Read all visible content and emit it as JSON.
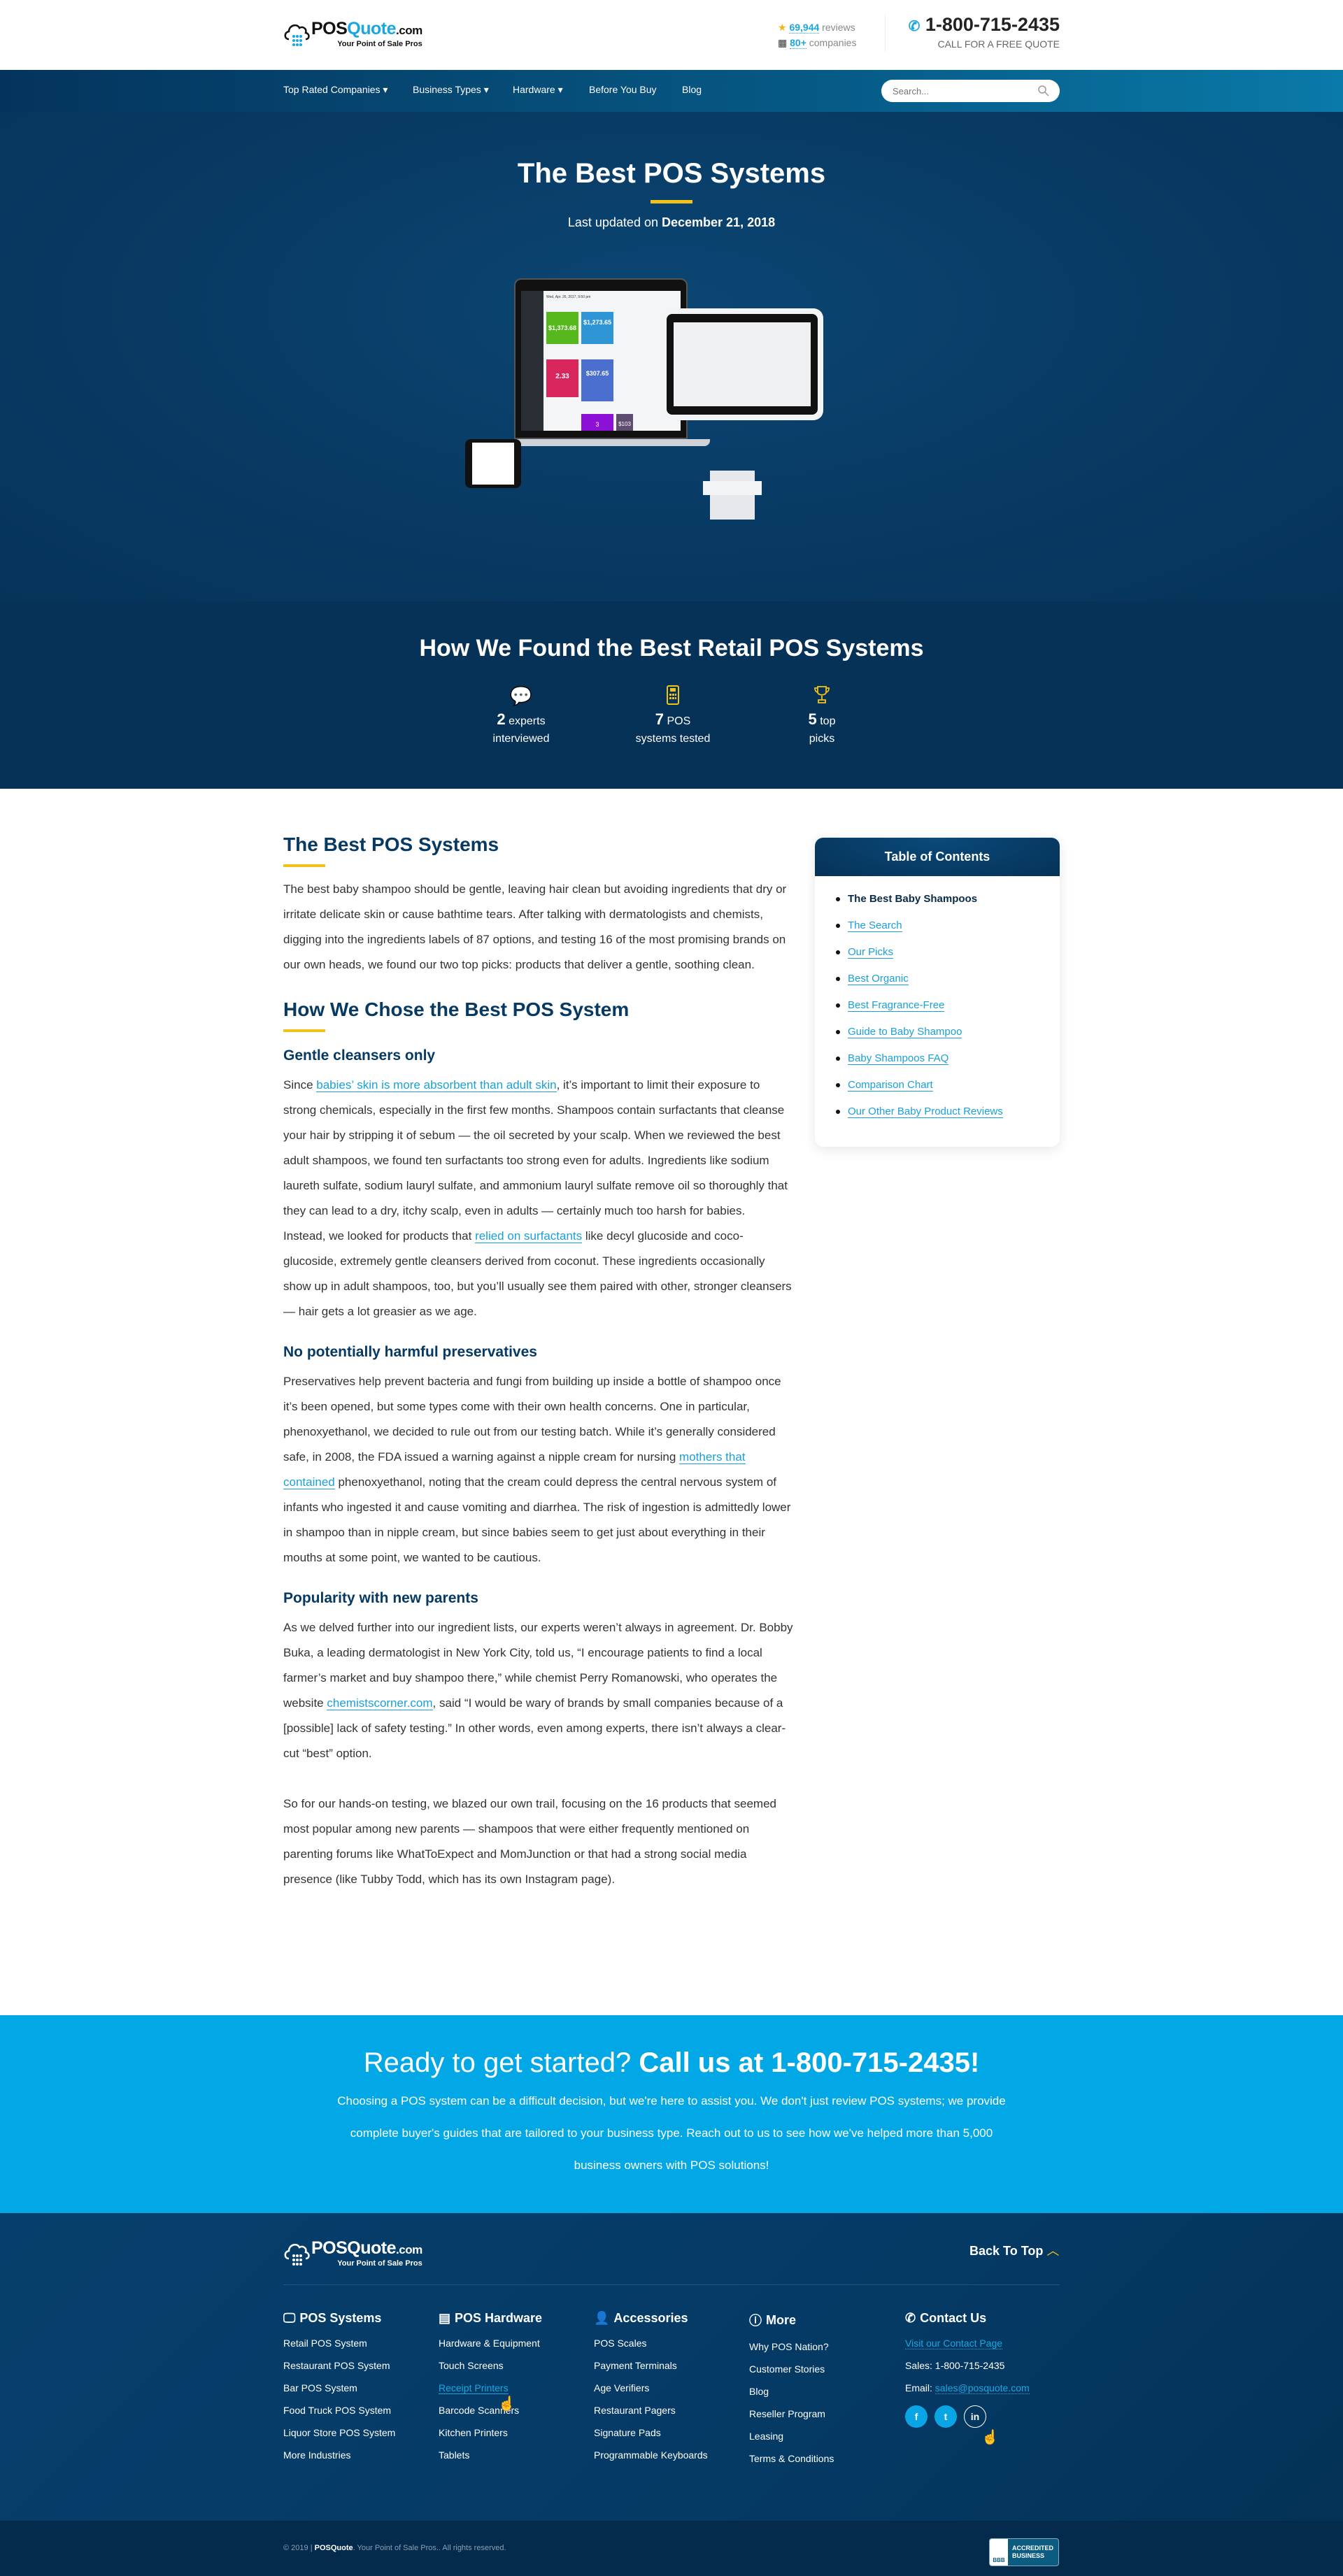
{
  "header": {
    "logo_brand_a": "POS",
    "logo_brand_b": "Quote",
    "logo_brand_c": ".com",
    "logo_tagline": "Your Point of Sale Pros",
    "reviews_count": "69,944",
    "reviews_label": "reviews",
    "companies_count": "80+",
    "companies_label": "companies",
    "phone": "1-800-715-2435",
    "phone_sub": "CALL FOR A FREE QUOTE"
  },
  "nav": {
    "items": [
      {
        "label": "Top Rated Companies",
        "dropdown": true
      },
      {
        "label": "Business Types",
        "dropdown": true
      },
      {
        "label": "Hardware",
        "dropdown": true
      },
      {
        "label": "Before You Buy",
        "dropdown": false
      },
      {
        "label": "Blog",
        "dropdown": false
      }
    ],
    "search_placeholder": "Search..."
  },
  "hero": {
    "title": "The Best POS Systems",
    "updated_prefix": "Last updated on",
    "updated_date": "December 21, 2018",
    "device_screen": {
      "date": "Wed, Apr. 26, 2017, 9:50 pm",
      "deposits_value": "$1,373.68",
      "gross_sales_value": "$1,273.65",
      "visits_value": "2.33",
      "invoices_value": "$307.65",
      "customers_value": "3",
      "spending_value": "$103"
    }
  },
  "stats": {
    "title": "How We Found the Best Retail POS Systems",
    "items": [
      {
        "icon": "chat-bubbles-icon",
        "num": "2",
        "l1": "experts",
        "l2": "interviewed"
      },
      {
        "icon": "pos-terminal-icon",
        "num": "7",
        "l1": "POS",
        "l2": "systems tested"
      },
      {
        "icon": "trophy-icon",
        "num": "5",
        "l1": "top",
        "l2": "picks"
      }
    ]
  },
  "article": {
    "h_best": "The Best POS Systems",
    "p_intro": "The best baby shampoo should be gentle, leaving hair clean but avoiding ingredients that dry or irritate delicate skin or cause bathtime tears. After talking with dermatologists and chemists, digging into the ingredients labels of 87 options, and testing 16 of the most promising brands on our own heads, we found our two top picks: products that deliver a gentle, soothing clean.",
    "h_chose": "How We Chose the Best POS System",
    "h_gentle": "Gentle cleansers only",
    "p_gentle1_a": "Since ",
    "p_gentle1_link": "babies’ skin is more absorbent than adult skin",
    "p_gentle1_b": ", it’s important to limit their exposure to strong chemicals, especially in the first few months. Shampoos contain surfactants that cleanse your hair by stripping it of sebum — the oil secreted by your scalp. When we reviewed the best adult shampoos, we found ten surfactants too strong even for adults. Ingredients like sodium laureth sulfate, sodium lauryl sulfate, and ammonium lauryl sulfate remove oil so thoroughly that they can lead to a dry, itchy scalp, even in adults — certainly much too harsh for babies.",
    "p_gentle2_a": "Instead, we looked for products that ",
    "p_gentle2_link": "relied on surfactants",
    "p_gentle2_b": " like decyl glucoside and coco-glucoside, extremely gentle cleansers derived from coconut. These ingredients occasionally show up in adult shampoos, too, but you’ll usually see them paired with other, stronger cleansers — hair gets a lot greasier as we age.",
    "h_preserv": "No potentially harmful preservatives",
    "p_preserv_a": "Preservatives help prevent bacteria and fungi from building up inside a bottle of shampoo once it’s been opened, but some types come with their own health concerns. One in particular, phenoxyethanol, we decided to rule out from our testing batch. While it’s generally considered safe, in 2008, the FDA issued a warning against a nipple cream for nursing ",
    "p_preserv_link": "mothers that contained",
    "p_preserv_b": " phenoxyethanol, noting that the cream could depress the central nervous system of infants who ingested it and cause vomiting and diarrhea. The risk of ingestion is admittedly lower in shampoo than in nipple cream, but since babies seem to get just about everything in their mouths at some point, we wanted to be cautious.",
    "h_popular": "Popularity with new parents",
    "p_popular_a": "As we delved further into our ingredient lists, our experts weren’t always in agreement. Dr. Bobby Buka, a leading dermatologist in New York City, told us, “I encourage patients to find a local farmer’s market and buy shampoo there,” while chemist Perry Romanowski, who operates the website ",
    "p_popular_link": "chemistscorner.com",
    "p_popular_b": ", said “I would be wary of brands by small companies because of a [possible] lack of safety testing.” In other words, even among experts, there isn’t always a clear-cut “best” option.",
    "p_final": "So for our hands-on testing, we blazed our own trail, focusing on the 16 products that seemed most popular among new parents — shampoos that were either frequently mentioned on parenting forums like WhatToExpect and MomJunction or that had a strong social media presence (like Tubby Todd, which has its own Instagram page)."
  },
  "toc": {
    "title": "Table of Contents",
    "items": [
      {
        "label": "The Best Baby Shampoos",
        "active": true
      },
      {
        "label": "The Search"
      },
      {
        "label": "Our Picks"
      },
      {
        "label": "Best Organic"
      },
      {
        "label": "Best Fragrance-Free"
      },
      {
        "label": "Guide to Baby Shampoo"
      },
      {
        "label": "Baby Shampoos FAQ"
      },
      {
        "label": "Comparison Chart"
      },
      {
        "label": "Our Other Baby Product Reviews"
      }
    ]
  },
  "cta": {
    "lead": "Ready to get started?",
    "bold": "Call us at 1-800-715-2435!",
    "text": "Choosing a POS system can be a difficult decision, but we're here to assist you. We don't just review POS systems; we provide complete buyer's guides that are tailored to your business type. Reach out to us to see how we've helped more than 5,000 business owners with POS solutions!"
  },
  "footer": {
    "back_to_top": "Back To Top",
    "columns": [
      {
        "icon": "monitor-icon",
        "title": "POS Systems",
        "items": [
          "Retail POS System",
          "Restaurant POS System",
          "Bar POS System",
          "Food Truck POS System",
          "Liquor Store POS System",
          "More Industries"
        ]
      },
      {
        "icon": "pos-terminal-icon",
        "title": "POS Hardware",
        "items": [
          "Hardware & Equipment",
          "Touch Screens",
          "Receipt Printers",
          "Barcode Scanners",
          "Kitchen Printers",
          "Tablets"
        ],
        "hovered": "Receipt Printers"
      },
      {
        "icon": "user-headset-icon",
        "title": "Accessories",
        "items": [
          "POS Scales",
          "Payment Terminals",
          "Age Verifiers",
          "Restaurant Pagers",
          "Signature Pads",
          "Programmable Keyboards"
        ]
      },
      {
        "icon": "info-icon",
        "title": "More",
        "items": [
          "Why POS Nation?",
          "Customer Stories",
          "Blog",
          "Reseller Program",
          "Leasing",
          "Terms & Conditions"
        ]
      }
    ],
    "contact": {
      "title": "Contact Us",
      "link": "Visit our Contact Page",
      "sales": "Sales: 1-800-715-2435",
      "email_label": "Email:",
      "email": "sales@posquote.com",
      "social": [
        "f",
        "t",
        "in"
      ]
    },
    "copyright_a": "© 2019 |",
    "copyright_brand": "POSQuote",
    "copyright_b": ". Your Point of Sale Pros.. All rights reserved.",
    "bbb_line1": "ACCREDITED",
    "bbb_line2": "BUSINESS",
    "bbb_logo": "BBB"
  },
  "colors": {
    "navy": "#063257",
    "accent_blue": "#1aa7e0",
    "yellow": "#f3c218",
    "cta_blue": "#02a8e6"
  }
}
